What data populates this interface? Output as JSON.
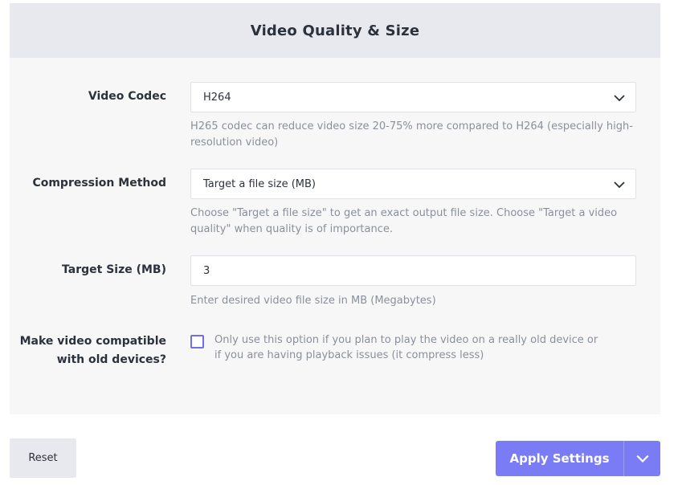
{
  "panel": {
    "title": "Video Quality & Size"
  },
  "fields": {
    "codec": {
      "label": "Video Codec",
      "value": "H264",
      "help": "H265 codec can reduce video size 20-75% more compared to H264 (especially high-resolution video)",
      "icon": "chevron-down-icon"
    },
    "compression": {
      "label": "Compression Method",
      "value": "Target a file size (MB)",
      "help": "Choose \"Target a file size\" to get an exact output file size. Choose \"Target a video quality\" when quality is of importance.",
      "icon": "chevron-down-icon"
    },
    "target_size": {
      "label": "Target Size (MB)",
      "value": "3",
      "help": "Enter desired video file size in MB (Megabytes)"
    },
    "compat": {
      "label": "Make video compatible with old devices?",
      "checked": false,
      "help": "Only use this option if you plan to play the video on a really old device or if you are having playback issues (it compress less)"
    }
  },
  "actions": {
    "reset_label": "Reset",
    "apply_label": "Apply Settings",
    "apply_dropdown_icon": "chevron-down-icon"
  },
  "colors": {
    "accent": "#7a7cf5",
    "checkbox_border": "#6d6ff0",
    "header_bg": "#e8e9ef",
    "panel_bg": "#f7f7f8"
  }
}
